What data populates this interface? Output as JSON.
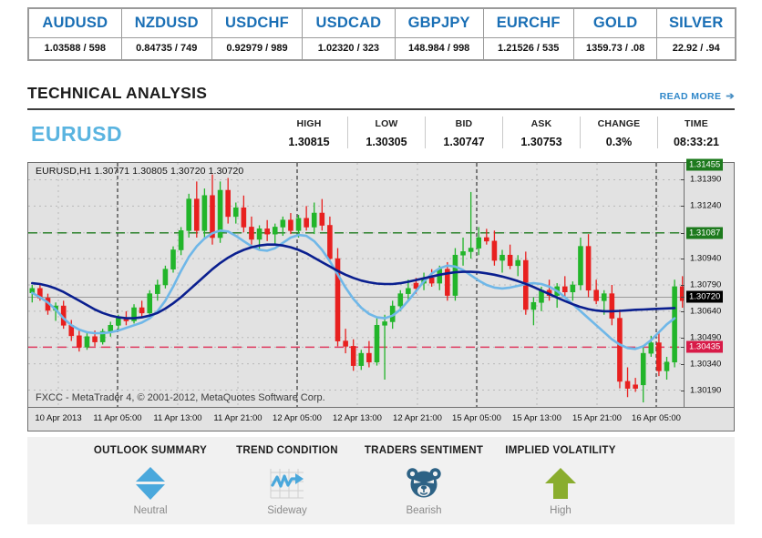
{
  "ticker": {
    "pairs": [
      {
        "symbol": "AUDUSD",
        "quote": "1.03588 / 598"
      },
      {
        "symbol": "NZDUSD",
        "quote": "0.84735 / 749"
      },
      {
        "symbol": "USDCHF",
        "quote": "0.92979 / 989"
      },
      {
        "symbol": "USDCAD",
        "quote": "1.02320 / 323"
      },
      {
        "symbol": "GBPJPY",
        "quote": "148.984 / 998"
      },
      {
        "symbol": "EURCHF",
        "quote": "1.21526 / 535"
      },
      {
        "symbol": "GOLD",
        "quote": "1359.73 / .08"
      },
      {
        "symbol": "SILVER",
        "quote": "22.92 / .94"
      }
    ]
  },
  "section": {
    "title": "TECHNICAL ANALYSIS",
    "read_more": "READ MORE",
    "read_more_arrow": "➔"
  },
  "quote": {
    "pair": "EURUSD",
    "stats": [
      {
        "label": "HIGH",
        "value": "1.30815"
      },
      {
        "label": "LOW",
        "value": "1.30305"
      },
      {
        "label": "BID",
        "value": "1.30747"
      },
      {
        "label": "ASK",
        "value": "1.30753"
      },
      {
        "label": "CHANGE",
        "value": "0.3%"
      },
      {
        "label": "TIME",
        "value": "08:33:21"
      }
    ]
  },
  "chart_data": {
    "type": "candlestick",
    "title": "EURUSD,H1  1.30771 1.30805 1.30720 1.30720",
    "symbol": "EURUSD",
    "timeframe": "H1",
    "ohlc_header": {
      "open": "1.30771",
      "high": "1.30805",
      "low": "1.30720",
      "close": "1.30720"
    },
    "watermark": "FXCC - MetaTrader 4, © 2001-2012, MetaQuotes Software Corp.",
    "ylim": [
      1.30115,
      1.31465
    ],
    "y_ticks": [
      "1.31390",
      "1.31240",
      "1.31087",
      "1.30940",
      "1.30790",
      "1.30720",
      "1.30640",
      "1.30490",
      "1.30435",
      "1.30340",
      "1.30190"
    ],
    "y_badges": [
      {
        "value": "1.31455",
        "color": "#1d7a1d",
        "text": "#ffffff",
        "clipped": true
      },
      {
        "value": "1.31087",
        "color": "#1d7a1d",
        "text": "#ffffff"
      },
      {
        "value": "1.30720",
        "color": "#000000",
        "text": "#ffffff"
      },
      {
        "value": "1.30435",
        "color": "#d81b48",
        "text": "#ffffff"
      }
    ],
    "hlines": [
      {
        "value": 1.31087,
        "color": "#1d7a1d",
        "style": "dashed"
      },
      {
        "value": 1.30435,
        "color": "#e03a5f",
        "style": "dashed"
      },
      {
        "value": 1.3072,
        "color": "#9a9a9a",
        "style": "solid"
      }
    ],
    "x_ticks": [
      "10 Apr 2013",
      "11 Apr 05:00",
      "11 Apr 13:00",
      "11 Apr 21:00",
      "12 Apr 05:00",
      "12 Apr 13:00",
      "12 Apr 21:00",
      "15 Apr 05:00",
      "15 Apr 13:00",
      "15 Apr 21:00",
      "16 Apr 05:00"
    ],
    "vlines_at_ticks": [
      1,
      4,
      7,
      10
    ],
    "colors": {
      "up": "#22b52a",
      "down": "#e8201f",
      "ma_fast": "#6fb7e8",
      "ma_slow": "#0a1f8f",
      "background": "#e2e2e2",
      "grid": "#b9b9b9"
    },
    "series": [
      {
        "name": "MA fast",
        "color": "#6fb7e8",
        "type": "line",
        "values": [
          1.30745,
          1.3072,
          1.3069,
          1.3065,
          1.306,
          1.3056,
          1.30535,
          1.3052,
          1.30515,
          1.30515,
          1.3052,
          1.3053,
          1.30545,
          1.3056,
          1.30575,
          1.306,
          1.3064,
          1.307,
          1.3078,
          1.3087,
          1.3095,
          1.3101,
          1.31055,
          1.31085,
          1.311,
          1.31095,
          1.3107,
          1.3104,
          1.3101,
          1.3099,
          1.30985,
          1.31,
          1.3103,
          1.3106,
          1.31075,
          1.3107,
          1.3104,
          1.3099,
          1.30925,
          1.3085,
          1.30775,
          1.3071,
          1.3066,
          1.30625,
          1.30605,
          1.306,
          1.30615,
          1.3065,
          1.307,
          1.30755,
          1.3081,
          1.30855,
          1.30885,
          1.309,
          1.30895,
          1.30875,
          1.30845,
          1.30815,
          1.3079,
          1.30775,
          1.3077,
          1.30775,
          1.30785,
          1.30795,
          1.308,
          1.30795,
          1.3078,
          1.30755,
          1.3072,
          1.3068,
          1.3064,
          1.306,
          1.3056,
          1.3052,
          1.3048,
          1.3045,
          1.3043,
          1.30425,
          1.3044,
          1.30475,
          1.3052,
          1.30565,
          1.306
        ]
      },
      {
        "name": "MA slow",
        "color": "#0a1f8f",
        "type": "line",
        "values": [
          1.308,
          1.30795,
          1.30785,
          1.3077,
          1.3075,
          1.30725,
          1.307,
          1.30675,
          1.3065,
          1.3063,
          1.30615,
          1.30605,
          1.306,
          1.306,
          1.30605,
          1.30615,
          1.3063,
          1.30655,
          1.30685,
          1.3072,
          1.3076,
          1.308,
          1.3084,
          1.3088,
          1.30915,
          1.30945,
          1.3097,
          1.3099,
          1.31005,
          1.31015,
          1.3102,
          1.3102,
          1.31015,
          1.31005,
          1.3099,
          1.3097,
          1.30945,
          1.3092,
          1.30895,
          1.3087,
          1.30848,
          1.3083,
          1.30815,
          1.30805,
          1.30798,
          1.30795,
          1.30795,
          1.308,
          1.30808,
          1.30818,
          1.30828,
          1.30838,
          1.30848,
          1.30856,
          1.30862,
          1.30865,
          1.30865,
          1.30862,
          1.30856,
          1.30848,
          1.30838,
          1.30826,
          1.30812,
          1.30796,
          1.30778,
          1.30758,
          1.30738,
          1.30718,
          1.30698,
          1.3068,
          1.30664,
          1.30652,
          1.30644,
          1.3064,
          1.3064,
          1.30642,
          1.30645,
          1.30648,
          1.3065,
          1.30652,
          1.30654,
          1.30656,
          1.30658
        ]
      }
    ],
    "candles": [
      {
        "o": 1.30745,
        "h": 1.3079,
        "l": 1.3069,
        "c": 1.3077,
        "d": "up"
      },
      {
        "o": 1.3077,
        "h": 1.308,
        "l": 1.307,
        "c": 1.30715,
        "d": "down"
      },
      {
        "o": 1.30715,
        "h": 1.3074,
        "l": 1.3062,
        "c": 1.30645,
        "d": "down"
      },
      {
        "o": 1.30645,
        "h": 1.3069,
        "l": 1.30585,
        "c": 1.3067,
        "d": "up"
      },
      {
        "o": 1.3067,
        "h": 1.307,
        "l": 1.3054,
        "c": 1.3056,
        "d": "down"
      },
      {
        "o": 1.3056,
        "h": 1.3059,
        "l": 1.3047,
        "c": 1.305,
        "d": "down"
      },
      {
        "o": 1.305,
        "h": 1.3053,
        "l": 1.3041,
        "c": 1.30435,
        "d": "down"
      },
      {
        "o": 1.30435,
        "h": 1.3052,
        "l": 1.3042,
        "c": 1.30495,
        "d": "up"
      },
      {
        "o": 1.30495,
        "h": 1.3053,
        "l": 1.3044,
        "c": 1.30465,
        "d": "down"
      },
      {
        "o": 1.30465,
        "h": 1.3054,
        "l": 1.3045,
        "c": 1.30525,
        "d": "up"
      },
      {
        "o": 1.30525,
        "h": 1.3058,
        "l": 1.30495,
        "c": 1.3056,
        "d": "up"
      },
      {
        "o": 1.3056,
        "h": 1.3062,
        "l": 1.3053,
        "c": 1.306,
        "d": "up"
      },
      {
        "o": 1.306,
        "h": 1.3064,
        "l": 1.3056,
        "c": 1.30585,
        "d": "down"
      },
      {
        "o": 1.30585,
        "h": 1.3068,
        "l": 1.3057,
        "c": 1.3066,
        "d": "up"
      },
      {
        "o": 1.3066,
        "h": 1.307,
        "l": 1.3061,
        "c": 1.3063,
        "d": "down"
      },
      {
        "o": 1.3063,
        "h": 1.3076,
        "l": 1.3062,
        "c": 1.3074,
        "d": "up"
      },
      {
        "o": 1.3074,
        "h": 1.3082,
        "l": 1.307,
        "c": 1.3079,
        "d": "up"
      },
      {
        "o": 1.3079,
        "h": 1.309,
        "l": 1.3077,
        "c": 1.3088,
        "d": "up"
      },
      {
        "o": 1.3088,
        "h": 1.3101,
        "l": 1.3086,
        "c": 1.3099,
        "d": "up"
      },
      {
        "o": 1.3099,
        "h": 1.3112,
        "l": 1.3096,
        "c": 1.311,
        "d": "up"
      },
      {
        "o": 1.311,
        "h": 1.3131,
        "l": 1.3106,
        "c": 1.3128,
        "d": "up"
      },
      {
        "o": 1.3128,
        "h": 1.3138,
        "l": 1.3106,
        "c": 1.311,
        "d": "down"
      },
      {
        "o": 1.311,
        "h": 1.3134,
        "l": 1.3105,
        "c": 1.313,
        "d": "up"
      },
      {
        "o": 1.313,
        "h": 1.3142,
        "l": 1.3102,
        "c": 1.3106,
        "d": "down"
      },
      {
        "o": 1.3106,
        "h": 1.3138,
        "l": 1.3103,
        "c": 1.3133,
        "d": "up"
      },
      {
        "o": 1.3133,
        "h": 1.314,
        "l": 1.3114,
        "c": 1.3118,
        "d": "down"
      },
      {
        "o": 1.3118,
        "h": 1.3126,
        "l": 1.3114,
        "c": 1.3123,
        "d": "up"
      },
      {
        "o": 1.3123,
        "h": 1.313,
        "l": 1.3109,
        "c": 1.3112,
        "d": "down"
      },
      {
        "o": 1.3112,
        "h": 1.3118,
        "l": 1.3102,
        "c": 1.3105,
        "d": "down"
      },
      {
        "o": 1.3105,
        "h": 1.3113,
        "l": 1.3099,
        "c": 1.3111,
        "d": "up"
      },
      {
        "o": 1.3111,
        "h": 1.3116,
        "l": 1.3104,
        "c": 1.3108,
        "d": "down"
      },
      {
        "o": 1.3108,
        "h": 1.3114,
        "l": 1.3102,
        "c": 1.3112,
        "d": "up"
      },
      {
        "o": 1.3112,
        "h": 1.3118,
        "l": 1.3107,
        "c": 1.3116,
        "d": "up"
      },
      {
        "o": 1.3116,
        "h": 1.312,
        "l": 1.3108,
        "c": 1.311,
        "d": "down"
      },
      {
        "o": 1.311,
        "h": 1.3119,
        "l": 1.3106,
        "c": 1.3117,
        "d": "up"
      },
      {
        "o": 1.3117,
        "h": 1.3124,
        "l": 1.311,
        "c": 1.3112,
        "d": "down"
      },
      {
        "o": 1.3112,
        "h": 1.3126,
        "l": 1.3108,
        "c": 1.312,
        "d": "up"
      },
      {
        "o": 1.312,
        "h": 1.3128,
        "l": 1.311,
        "c": 1.3113,
        "d": "down"
      },
      {
        "o": 1.3113,
        "h": 1.3118,
        "l": 1.3092,
        "c": 1.3094,
        "d": "down"
      },
      {
        "o": 1.3094,
        "h": 1.31,
        "l": 1.3044,
        "c": 1.3047,
        "d": "down"
      },
      {
        "o": 1.3047,
        "h": 1.3054,
        "l": 1.304,
        "c": 1.3044,
        "d": "down"
      },
      {
        "o": 1.3044,
        "h": 1.3048,
        "l": 1.303,
        "c": 1.3033,
        "d": "down"
      },
      {
        "o": 1.3033,
        "h": 1.3042,
        "l": 1.30305,
        "c": 1.304,
        "d": "up"
      },
      {
        "o": 1.304,
        "h": 1.3047,
        "l": 1.3032,
        "c": 1.3035,
        "d": "down"
      },
      {
        "o": 1.3035,
        "h": 1.306,
        "l": 1.3033,
        "c": 1.3056,
        "d": "up"
      },
      {
        "o": 1.3056,
        "h": 1.3062,
        "l": 1.3025,
        "c": 1.3058,
        "d": "up"
      },
      {
        "o": 1.3058,
        "h": 1.307,
        "l": 1.3054,
        "c": 1.3067,
        "d": "up"
      },
      {
        "o": 1.3067,
        "h": 1.3076,
        "l": 1.3064,
        "c": 1.3074,
        "d": "up"
      },
      {
        "o": 1.3074,
        "h": 1.3082,
        "l": 1.307,
        "c": 1.3077,
        "d": "up"
      },
      {
        "o": 1.3077,
        "h": 1.3083,
        "l": 1.3074,
        "c": 1.308,
        "d": "down"
      },
      {
        "o": 1.308,
        "h": 1.3086,
        "l": 1.3076,
        "c": 1.3083,
        "d": "up"
      },
      {
        "o": 1.3083,
        "h": 1.3088,
        "l": 1.3078,
        "c": 1.308,
        "d": "down"
      },
      {
        "o": 1.308,
        "h": 1.309,
        "l": 1.3076,
        "c": 1.3088,
        "d": "up"
      },
      {
        "o": 1.3088,
        "h": 1.3092,
        "l": 1.307,
        "c": 1.3073,
        "d": "down"
      },
      {
        "o": 1.3073,
        "h": 1.31,
        "l": 1.307,
        "c": 1.3096,
        "d": "up"
      },
      {
        "o": 1.3096,
        "h": 1.3106,
        "l": 1.309,
        "c": 1.3098,
        "d": "up"
      },
      {
        "o": 1.3098,
        "h": 1.3132,
        "l": 1.3094,
        "c": 1.31,
        "d": "up"
      },
      {
        "o": 1.31,
        "h": 1.3112,
        "l": 1.3096,
        "c": 1.3106,
        "d": "up"
      },
      {
        "o": 1.3106,
        "h": 1.3111,
        "l": 1.3102,
        "c": 1.3104,
        "d": "down"
      },
      {
        "o": 1.3104,
        "h": 1.311,
        "l": 1.309,
        "c": 1.3093,
        "d": "down"
      },
      {
        "o": 1.3093,
        "h": 1.3099,
        "l": 1.3086,
        "c": 1.3096,
        "d": "up"
      },
      {
        "o": 1.3096,
        "h": 1.3102,
        "l": 1.3088,
        "c": 1.309,
        "d": "down"
      },
      {
        "o": 1.309,
        "h": 1.3096,
        "l": 1.3084,
        "c": 1.3093,
        "d": "up"
      },
      {
        "o": 1.3093,
        "h": 1.3098,
        "l": 1.3062,
        "c": 1.3065,
        "d": "down"
      },
      {
        "o": 1.3065,
        "h": 1.3072,
        "l": 1.3056,
        "c": 1.3069,
        "d": "up"
      },
      {
        "o": 1.3069,
        "h": 1.3078,
        "l": 1.3064,
        "c": 1.3076,
        "d": "up"
      },
      {
        "o": 1.3076,
        "h": 1.3082,
        "l": 1.307,
        "c": 1.3073,
        "d": "down"
      },
      {
        "o": 1.3073,
        "h": 1.308,
        "l": 1.3066,
        "c": 1.3078,
        "d": "up"
      },
      {
        "o": 1.3078,
        "h": 1.3084,
        "l": 1.3072,
        "c": 1.3075,
        "d": "down"
      },
      {
        "o": 1.3075,
        "h": 1.3081,
        "l": 1.307,
        "c": 1.3079,
        "d": "up"
      },
      {
        "o": 1.3079,
        "h": 1.3106,
        "l": 1.3076,
        "c": 1.3101,
        "d": "up"
      },
      {
        "o": 1.3101,
        "h": 1.3108,
        "l": 1.3072,
        "c": 1.3076,
        "d": "down"
      },
      {
        "o": 1.3076,
        "h": 1.3082,
        "l": 1.3068,
        "c": 1.307,
        "d": "down"
      },
      {
        "o": 1.307,
        "h": 1.3076,
        "l": 1.3062,
        "c": 1.3074,
        "d": "up"
      },
      {
        "o": 1.3074,
        "h": 1.3079,
        "l": 1.3056,
        "c": 1.306,
        "d": "down"
      },
      {
        "o": 1.306,
        "h": 1.3065,
        "l": 1.302,
        "c": 1.3024,
        "d": "down"
      },
      {
        "o": 1.3024,
        "h": 1.3032,
        "l": 1.3015,
        "c": 1.302,
        "d": "down"
      },
      {
        "o": 1.302,
        "h": 1.3026,
        "l": 1.3018,
        "c": 1.3022,
        "d": "down"
      },
      {
        "o": 1.3022,
        "h": 1.3044,
        "l": 1.3012,
        "c": 1.304,
        "d": "up"
      },
      {
        "o": 1.304,
        "h": 1.305,
        "l": 1.3038,
        "c": 1.3046,
        "d": "up"
      },
      {
        "o": 1.3046,
        "h": 1.3052,
        "l": 1.3027,
        "c": 1.303,
        "d": "down"
      },
      {
        "o": 1.303,
        "h": 1.3038,
        "l": 1.3025,
        "c": 1.3035,
        "d": "up"
      },
      {
        "o": 1.3035,
        "h": 1.3082,
        "l": 1.3032,
        "c": 1.3078,
        "d": "up"
      },
      {
        "o": 1.3078,
        "h": 1.3084,
        "l": 1.3066,
        "c": 1.307,
        "d": "down"
      }
    ]
  },
  "indicators": [
    {
      "title": "OUTLOOK SUMMARY",
      "value": "Neutral",
      "icon": "neutral-diamond-icon",
      "color": "#4aa8dc"
    },
    {
      "title": "TREND CONDITION",
      "value": "Sideway",
      "icon": "zigzag-arrow-icon",
      "color": "#4aa8dc"
    },
    {
      "title": "TRADERS SENTIMENT",
      "value": "Bearish",
      "icon": "bear-face-icon",
      "color": "#2d6285"
    },
    {
      "title": "IMPLIED VOLATILITY",
      "value": "High",
      "icon": "up-arrow-icon",
      "color": "#8aad2e"
    }
  ]
}
